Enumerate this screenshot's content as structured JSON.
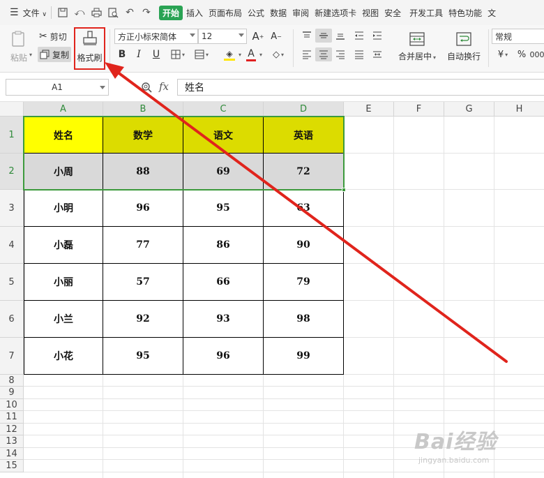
{
  "menubar": {
    "file_label": "文件",
    "menus": [
      "开始",
      "插入",
      "页面布局",
      "公式",
      "数据",
      "审阅",
      "新建选项卡",
      "视图",
      "安全",
      "开发工具",
      "特色功能",
      "文"
    ]
  },
  "ribbon": {
    "paste_label": "粘贴",
    "cut_label": "剪切",
    "copy_label": "复制",
    "format_painter_label": "格式刷",
    "font_name": "方正小标宋简体",
    "font_size": "12",
    "bold_label": "B",
    "italic_label": "I",
    "underline_label": "U",
    "font_color_label": "A",
    "merge_center_label": "合并居中",
    "wrap_text_label": "自动换行",
    "number_format": "常规",
    "percent_label": "%"
  },
  "formula_bar": {
    "cell_ref": "A1",
    "fx_label": "fx",
    "formula_value": "姓名"
  },
  "grid": {
    "columns": [
      "A",
      "B",
      "C",
      "D",
      "E",
      "F",
      "G",
      "H"
    ],
    "rows": [
      "1",
      "2",
      "3",
      "4",
      "5",
      "6",
      "7",
      "8",
      "9",
      "10",
      "11",
      "12",
      "13",
      "14",
      "15"
    ],
    "table": [
      [
        "姓名",
        "数学",
        "语文",
        "英语"
      ],
      [
        "小周",
        "88",
        "69",
        "72"
      ],
      [
        "小明",
        "96",
        "95",
        "63"
      ],
      [
        "小磊",
        "77",
        "86",
        "90"
      ],
      [
        "小丽",
        "57",
        "66",
        "79"
      ],
      [
        "小兰",
        "92",
        "93",
        "98"
      ],
      [
        "小花",
        "95",
        "96",
        "99"
      ]
    ]
  },
  "colors": {
    "active_tab": "#2aa354",
    "selection_border": "#3c9a3c",
    "header_name_fill": "#ffff00",
    "header_subject_fill": "#dcdc00",
    "row2_fill": "#d9d9d9",
    "annotation_red": "#e0241c"
  },
  "watermark": {
    "brand": "Bai经验",
    "url": "jingyan.baidu.com"
  }
}
